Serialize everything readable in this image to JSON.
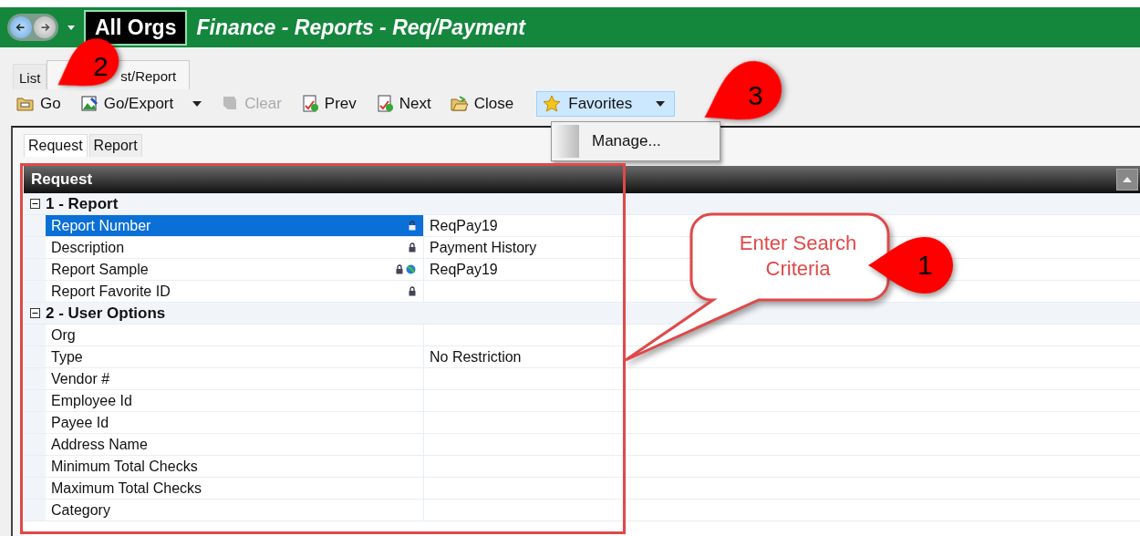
{
  "title_bar": {
    "org": "All Orgs",
    "title": "Finance - Reports - Req/Payment"
  },
  "tabs": [
    {
      "label": "List",
      "selected": false
    },
    {
      "label": "st/Report",
      "selected": true
    }
  ],
  "toolbar": [
    {
      "kind": "go",
      "label": "Go",
      "disabled": false,
      "menu": false
    },
    {
      "kind": "export",
      "label": "Go/Export",
      "disabled": false,
      "menu": true
    },
    {
      "kind": "clear",
      "label": "Clear",
      "disabled": true,
      "menu": false
    },
    {
      "kind": "prev",
      "label": "Prev",
      "disabled": false,
      "menu": false
    },
    {
      "kind": "next",
      "label": "Next",
      "disabled": false,
      "menu": false
    },
    {
      "kind": "close",
      "label": "Close",
      "disabled": false,
      "menu": false
    }
  ],
  "favorites": {
    "label": "Favorites",
    "expanded": true,
    "menu_items": [
      "Manage..."
    ]
  },
  "inner_tabs": [
    {
      "label": "Request",
      "selected": true
    },
    {
      "label": "Report",
      "selected": false
    }
  ],
  "grid": {
    "title": "Request",
    "sections": [
      {
        "title": "1 - Report",
        "expanded": true,
        "rows": [
          {
            "label": "Report Number",
            "value": "ReqPay19",
            "selected": true,
            "locked": true,
            "globe": false
          },
          {
            "label": "Description",
            "value": "Payment History",
            "selected": false,
            "locked": true,
            "globe": false
          },
          {
            "label": "Report Sample",
            "value": "ReqPay19",
            "selected": false,
            "locked": true,
            "globe": true
          },
          {
            "label": "Report Favorite ID",
            "value": "",
            "selected": false,
            "locked": true,
            "globe": false
          }
        ]
      },
      {
        "title": "2 - User Options",
        "expanded": true,
        "rows": [
          {
            "label": "Org",
            "value": "",
            "selected": false
          },
          {
            "label": "Type",
            "value": "No Restriction",
            "selected": false
          },
          {
            "label": "Vendor #",
            "value": "",
            "selected": false
          },
          {
            "label": "Employee Id",
            "value": "",
            "selected": false
          },
          {
            "label": "Payee Id",
            "value": "",
            "selected": false
          },
          {
            "label": "Address Name",
            "value": "",
            "selected": false
          },
          {
            "label": "Minimum Total Checks",
            "value": "",
            "selected": false
          },
          {
            "label": "Maximum Total Checks",
            "value": "",
            "selected": false
          },
          {
            "label": "Category",
            "value": "",
            "selected": false
          }
        ]
      }
    ]
  },
  "annotations": {
    "callout": "Enter Search Criteria",
    "markers": [
      "2",
      "3",
      "1"
    ]
  }
}
